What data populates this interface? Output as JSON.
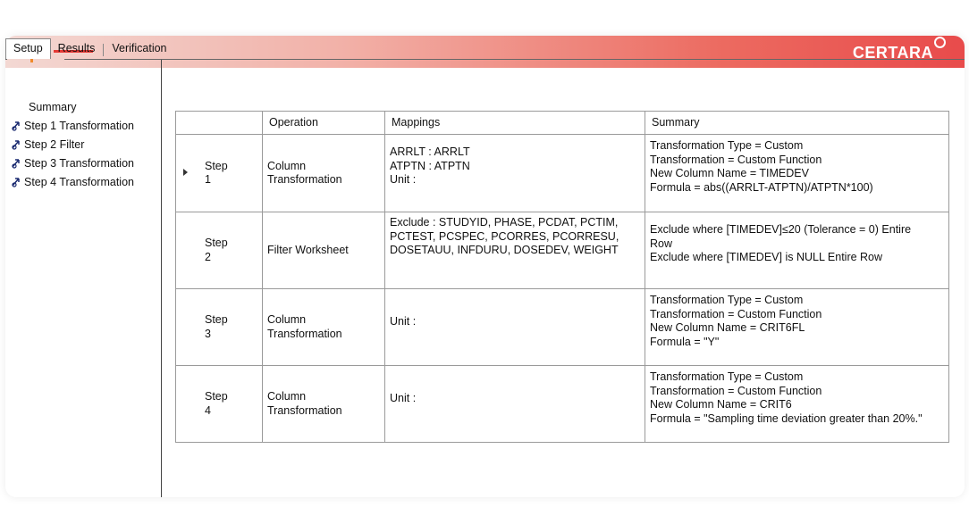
{
  "brand": {
    "name": "CERTARA"
  },
  "tabs": [
    "Setup",
    "Results",
    "Verification"
  ],
  "tree": {
    "items": [
      {
        "label": "Summary"
      },
      {
        "label": "Step 1 Transformation"
      },
      {
        "label": "Step 2 Filter"
      },
      {
        "label": "Step 3 Transformation"
      },
      {
        "label": "Step 4 Transformation"
      }
    ]
  },
  "table": {
    "headers": [
      "",
      "Operation",
      "Mappings",
      "Summary"
    ],
    "rows": [
      {
        "step": "Step\n1",
        "operation": "Column\nTransformation",
        "mappings": "ARRLT : ARRLT\nATPTN : ATPTN\nUnit :",
        "summary": "Transformation Type = Custom\nTransformation = Custom Function\nNew Column Name = TIMEDEV\nFormula = abs((ARRLT-ATPTN)/ATPTN*100)"
      },
      {
        "step": "Step\n2",
        "operation": "Filter Worksheet",
        "mappings": "Exclude : STUDYID, PHASE, PCDAT, PCTIM,\nPCTEST, PCSPEC, PCORRES, PCORRESU,\nDOSETAUU, INFDURU, DOSEDEV, WEIGHT",
        "summary": "Exclude where [TIMEDEV]≤20 (Tolerance = 0) Entire\nRow\nExclude where [TIMEDEV] is NULL Entire Row"
      },
      {
        "step": "Step\n3",
        "operation": "Column\nTransformation",
        "mappings": "Unit :",
        "summary": "Transformation Type = Custom\nTransformation = Custom Function\nNew Column Name = CRIT6FL\nFormula = \"Y\""
      },
      {
        "step": "Step\n4",
        "operation": "Column\nTransformation",
        "mappings": "Unit :",
        "summary": "Transformation Type = Custom\nTransformation = Custom Function\nNew Column Name = CRIT6\nFormula = \"Sampling time deviation greater than 20%.\""
      }
    ]
  }
}
